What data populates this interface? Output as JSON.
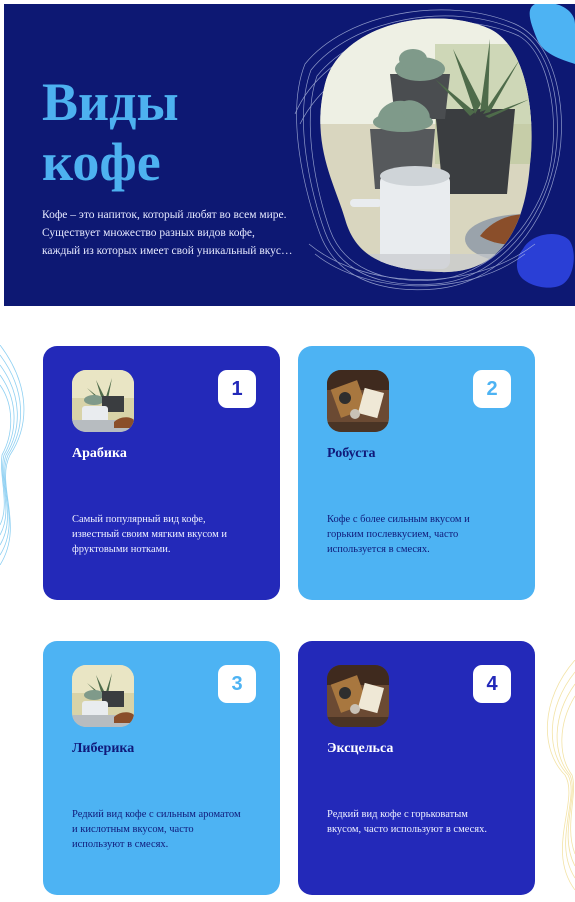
{
  "hero": {
    "title_line1": "Виды",
    "title_line2": "кофе",
    "description_line1": "Кофе – это напиток, который любят во всем мире.",
    "description_line2": "Существует множество разных видов кофе,",
    "description_line3": "каждый из которых имеет свой уникальный вкус…"
  },
  "colors": {
    "hero_bg": "#0d1873",
    "accent_light": "#4db3f3",
    "accent_dark": "#2329b9",
    "title": "#4db1f0"
  },
  "cards": [
    {
      "number": "1",
      "name": "Арабика",
      "desc_line1": "Самый популярный вид кофе,",
      "desc_line2": "известный своим мягким вкусом и",
      "desc_line3": "фруктовыми нотками.",
      "style": "dark",
      "thumb": "succulent-mug-photo"
    },
    {
      "number": "2",
      "name": "Робуста",
      "desc_line1": "Кофе с более сильным вкусом и",
      "desc_line2": "горьким послевкусием, часто",
      "desc_line3": "используется в смесях.",
      "style": "light",
      "thumb": "coffee-table-photo"
    },
    {
      "number": "3",
      "name": "Либерика",
      "desc_line1": "Редкий вид кофе с сильным ароматом",
      "desc_line2": "и кислотным вкусом, часто",
      "desc_line3": "используют в смесях.",
      "style": "light",
      "thumb": "succulent-mug-photo"
    },
    {
      "number": "4",
      "name": "Эксцельса",
      "desc_line1": "Редкий вид кофе с горьковатым",
      "desc_line2": "вкусом, часто используют в смесях.",
      "desc_line3": "",
      "style": "dark",
      "thumb": "coffee-table-photo"
    }
  ]
}
